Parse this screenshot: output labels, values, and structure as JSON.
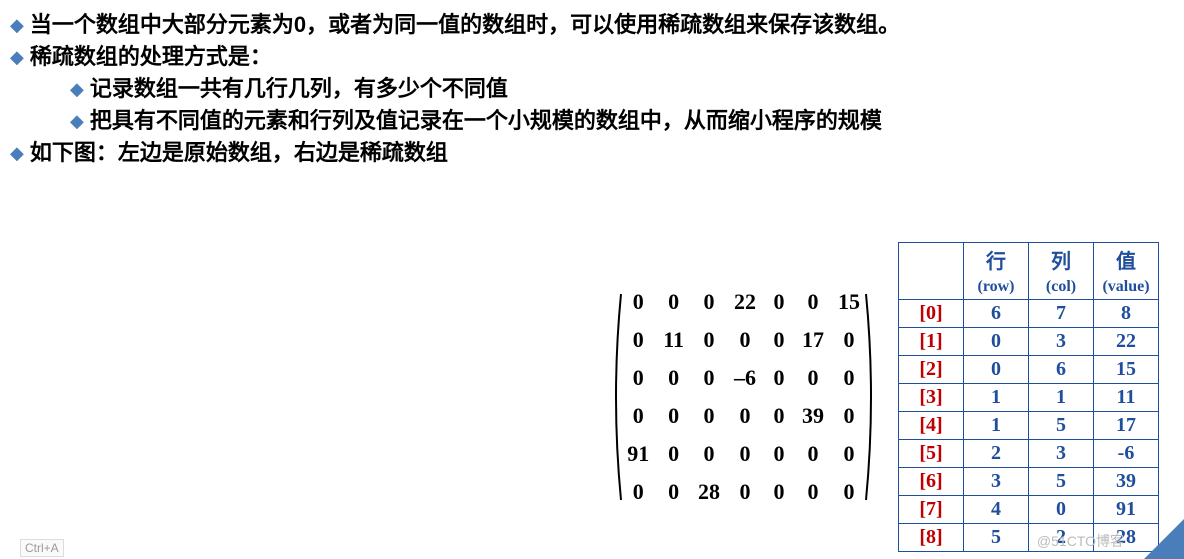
{
  "bullets": {
    "b1": "当一个数组中大部分元素为0，或者为同一值的数组时，可以使用稀疏数组来保存该数组。",
    "b2": "稀疏数组的处理方式是：",
    "b2a": "记录数组一共有几行几列，有多少个不同值",
    "b2b": "把具有不同值的元素和行列及值记录在一个小规模的数组中，从而缩小程序的规模",
    "b3": "如下图：左边是原始数组，右边是稀疏数组"
  },
  "matrix": {
    "rows": [
      [
        "0",
        "0",
        "0",
        "22",
        "0",
        "0",
        "15"
      ],
      [
        "0",
        "11",
        "0",
        "0",
        "0",
        "17",
        "0"
      ],
      [
        "0",
        "0",
        "0",
        "–6",
        "0",
        "0",
        "0"
      ],
      [
        "0",
        "0",
        "0",
        "0",
        "0",
        "39",
        "0"
      ],
      [
        "91",
        "0",
        "0",
        "0",
        "0",
        "0",
        "0"
      ],
      [
        "0",
        "0",
        "28",
        "0",
        "0",
        "0",
        "0"
      ]
    ]
  },
  "sparse": {
    "header": {
      "row_cn": "行",
      "row_en": "(row)",
      "col_cn": "列",
      "col_en": "(col)",
      "val_cn": "值",
      "val_en": "(value)"
    },
    "rows": [
      {
        "idx": "[0]",
        "r": "6",
        "c": "7",
        "v": "8"
      },
      {
        "idx": "[1]",
        "r": "0",
        "c": "3",
        "v": "22"
      },
      {
        "idx": "[2]",
        "r": "0",
        "c": "6",
        "v": "15"
      },
      {
        "idx": "[3]",
        "r": "1",
        "c": "1",
        "v": "11"
      },
      {
        "idx": "[4]",
        "r": "1",
        "c": "5",
        "v": "17"
      },
      {
        "idx": "[5]",
        "r": "2",
        "c": "3",
        "v": "-6"
      },
      {
        "idx": "[6]",
        "r": "3",
        "c": "5",
        "v": "39"
      },
      {
        "idx": "[7]",
        "r": "4",
        "c": "0",
        "v": "91"
      },
      {
        "idx": "[8]",
        "r": "5",
        "c": "2",
        "v": "28"
      }
    ]
  },
  "watermark": "@51CTO博客",
  "ctrla": "Ctrl+A"
}
